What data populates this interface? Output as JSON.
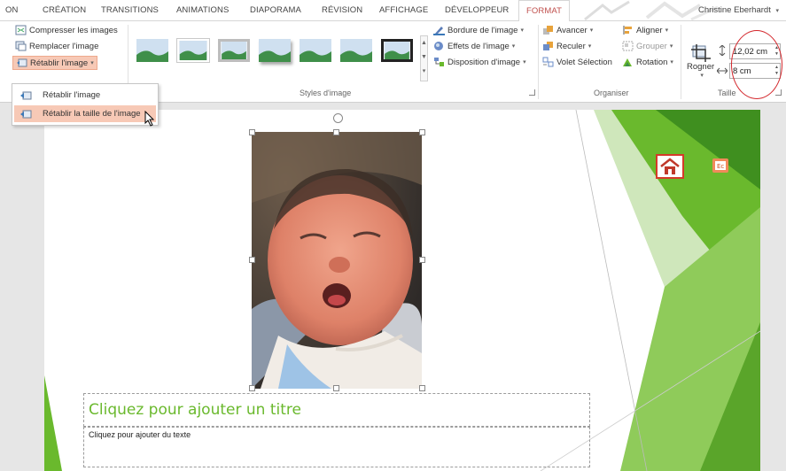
{
  "tabs": [
    {
      "label": "ON",
      "active": false
    },
    {
      "label": "CRÉATION",
      "active": false
    },
    {
      "label": "TRANSITIONS",
      "active": false
    },
    {
      "label": "ANIMATIONS",
      "active": false
    },
    {
      "label": "DIAPORAMA",
      "active": false
    },
    {
      "label": "RÉVISION",
      "active": false
    },
    {
      "label": "AFFICHAGE",
      "active": false
    },
    {
      "label": "DÉVELOPPEUR",
      "active": false
    },
    {
      "label": "FORMAT",
      "active": true
    }
  ],
  "user_name": "Christine Eberhardt",
  "ribbon": {
    "adjust": {
      "compress": "Compresser les images",
      "replace": "Remplacer l'image",
      "reset": "Rétablir l'image"
    },
    "styles_label": "Styles d'image",
    "picture_options": {
      "border": "Bordure de l'image",
      "effects": "Effets de l'image",
      "layout": "Disposition d'image"
    },
    "arrange": {
      "forward": "Avancer",
      "backward": "Reculer",
      "selection_pane": "Volet Sélection",
      "align": "Aligner",
      "group": "Grouper",
      "rotate": "Rotation",
      "label": "Organiser"
    },
    "size": {
      "crop": "Rogner",
      "height": "12,02 cm",
      "width": "8 cm",
      "label": "Taille"
    }
  },
  "reset_menu": {
    "items": [
      {
        "label": "Rétablir l'image",
        "highlighted": false
      },
      {
        "label": "Rétablir la taille de l'image",
        "highlighted": true
      }
    ]
  },
  "slide": {
    "title_placeholder": "Cliquez pour ajouter un titre",
    "body_placeholder": "Cliquez pour ajouter du texte"
  },
  "colors": {
    "accent_red": "#c0504d",
    "highlight": "#f7c9b6",
    "slide_green": "#6ab92d",
    "annotation_circle": "#d3262b"
  }
}
